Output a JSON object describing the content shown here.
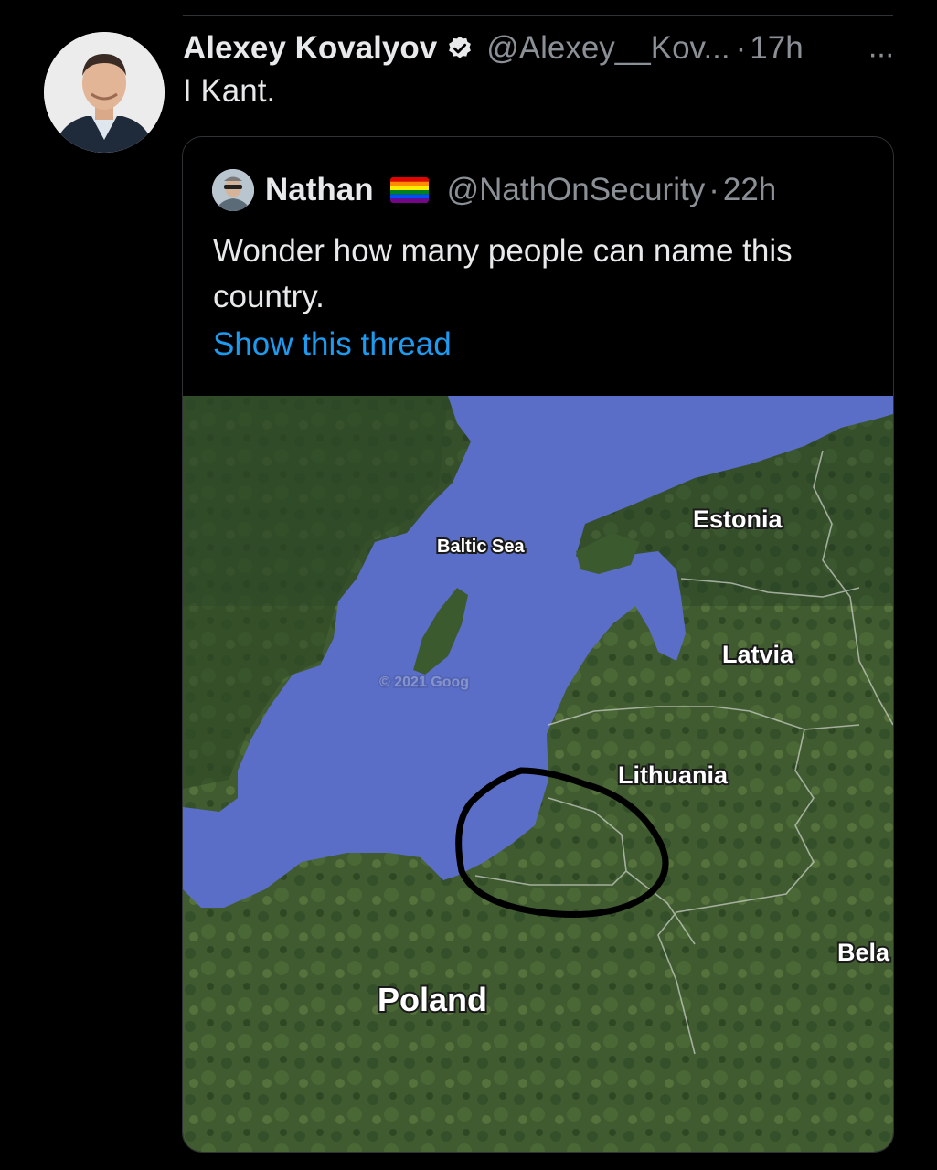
{
  "tweet": {
    "author_name": "Alexey Kovalyov",
    "handle": "@Alexey__Kov...",
    "separator": "·",
    "time": "17h",
    "more_label": "···",
    "text": "I Kant."
  },
  "quote": {
    "author_name": "Nathan",
    "flag_icon": "rainbow-flag-icon",
    "handle": "@NathOnSecurity",
    "separator": "·",
    "time": "22h",
    "text": "Wonder how many people can name this country.",
    "show_thread": "Show this thread",
    "map": {
      "labels": {
        "baltic_sea": "Baltic Sea",
        "estonia": "Estonia",
        "latvia": "Latvia",
        "lithuania": "Lithuania",
        "poland": "Poland",
        "belarus": "Bela",
        "watermark": "© 2021 Goog"
      }
    }
  },
  "colors": {
    "background": "#000000",
    "link": "#1d9bf0",
    "secondary_text": "#8b9096",
    "primary_text": "#e7e9ea",
    "sea": "#5a6ec8",
    "land": "#3d5a2e"
  }
}
